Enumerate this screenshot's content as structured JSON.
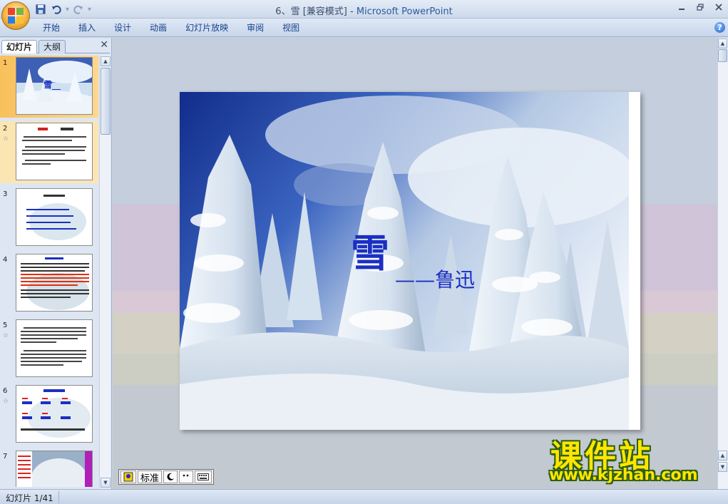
{
  "window": {
    "title_doc": "6、雪 [兼容模式]",
    "title_sep": " - ",
    "title_app": "Microsoft PowerPoint"
  },
  "quick_access": {
    "icons": [
      "save-icon",
      "undo-icon",
      "redo-icon",
      "customize-dropdown-icon"
    ]
  },
  "ribbon": {
    "tabs": [
      "开始",
      "插入",
      "设计",
      "动画",
      "幻灯片放映",
      "审阅",
      "视图"
    ],
    "help_label": "?"
  },
  "pane": {
    "tab_slides": "幻灯片",
    "tab_outline": "大纲",
    "close_label": "✕",
    "slides": [
      {
        "number": "1",
        "selected": true
      },
      {
        "number": "2",
        "has_animation": true
      },
      {
        "number": "3"
      },
      {
        "number": "4"
      },
      {
        "number": "5",
        "has_animation": true
      },
      {
        "number": "6",
        "has_animation": true
      },
      {
        "number": "7"
      }
    ]
  },
  "slide": {
    "title": "雪",
    "subtitle": "——鲁迅"
  },
  "ime": {
    "mode": "标准"
  },
  "status": {
    "slide_indicator": "幻灯片 1/41"
  },
  "watermark": {
    "text": "课件站",
    "url": "www.kjzhan.com"
  },
  "colors": {
    "title_text": "#1b2fc2",
    "selected_thumb": "#f9c05b",
    "ribbon_tab_text": "#15428b"
  }
}
